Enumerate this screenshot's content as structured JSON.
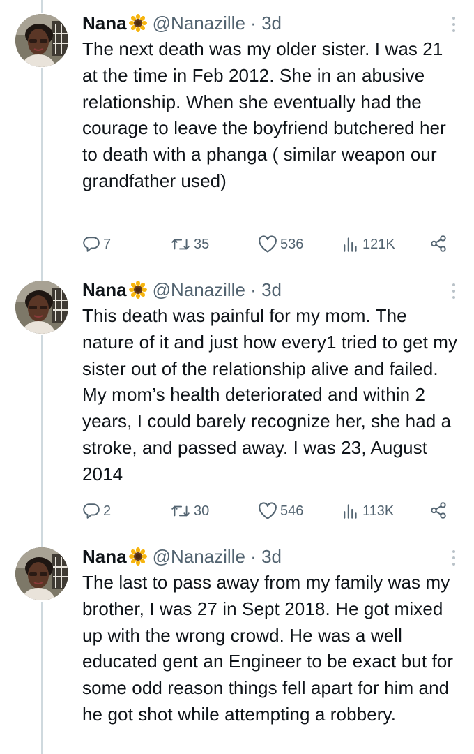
{
  "colors": {
    "text": "#0f1419",
    "secondary": "#536471",
    "thread_line": "#cfd9de",
    "background": "#ffffff"
  },
  "icons": [
    "sunflower-emoji",
    "more-icon",
    "reply-icon",
    "retweet-icon",
    "like-icon",
    "views-icon",
    "share-icon"
  ],
  "tweets": [
    {
      "author_name": "Nana",
      "emoji": "🌻",
      "handle": "@Nanazille",
      "separator": "·",
      "age": "3d",
      "text": "The next death was my older sister. I was 21 at the time in Feb 2012.  She in an abusive relationship. When she eventually had the courage to leave the boyfriend butchered her to death with a phanga ( similar weapon our grandfather used)",
      "replies": "7",
      "retweets": "35",
      "likes": "536",
      "views": "121K"
    },
    {
      "author_name": "Nana",
      "emoji": "🌻",
      "handle": "@Nanazille",
      "separator": "·",
      "age": "3d",
      "text": "This death was  painful for my mom. The nature of it and just how every1 tried to get my sister out of the relationship alive and failed. My mom’s health deteriorated and within 2 years, I could barely recognize her, she had a stroke, and passed away. I was 23, August 2014",
      "replies": "2",
      "retweets": "30",
      "likes": "546",
      "views": "113K"
    },
    {
      "author_name": "Nana",
      "emoji": "🌻",
      "handle": "@Nanazille",
      "separator": "·",
      "age": "3d",
      "text": "The last to pass away from my family was my brother, I was 27 in Sept 2018. He got mixed up with the wrong crowd. He was a well educated gent an Engineer to be exact but for some odd reason things fell apart for him and he got shot while attempting a robbery."
    }
  ]
}
